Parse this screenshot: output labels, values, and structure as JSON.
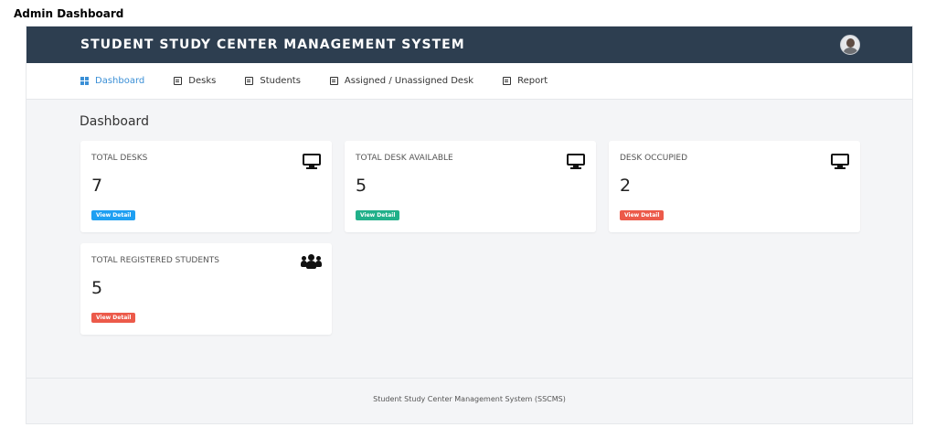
{
  "caption": "Admin Dashboard",
  "header": {
    "title": "STUDENT STUDY CENTER MANAGEMENT SYSTEM"
  },
  "nav": {
    "items": [
      {
        "label": "Dashboard"
      },
      {
        "label": "Desks"
      },
      {
        "label": "Students"
      },
      {
        "label": "Assigned / Unassigned Desk"
      },
      {
        "label": "Report"
      }
    ]
  },
  "page": {
    "title": "Dashboard"
  },
  "cards": [
    {
      "label": "TOTAL DESKS",
      "value": "7",
      "button": "View Detail",
      "icon": "monitor-icon",
      "button_color": "#1e9ff2"
    },
    {
      "label": "TOTAL DESK AVAILABLE",
      "value": "5",
      "button": "View Detail",
      "icon": "monitor-icon",
      "button_color": "#21b08a"
    },
    {
      "label": "DESK OCCUPIED",
      "value": "2",
      "button": "View Detail",
      "icon": "monitor-icon",
      "button_color": "#ec5a4a"
    },
    {
      "label": "TOTAL REGISTERED STUDENTS",
      "value": "5",
      "button": "View Detail",
      "icon": "users-icon",
      "button_color": "#ec5a4a"
    }
  ],
  "footer": {
    "text": "Student Study Center Management System (SSCMS)"
  },
  "colors": {
    "topbar": "#2d3e50",
    "active_nav": "#3a8fd6",
    "background": "#f4f5f7"
  }
}
